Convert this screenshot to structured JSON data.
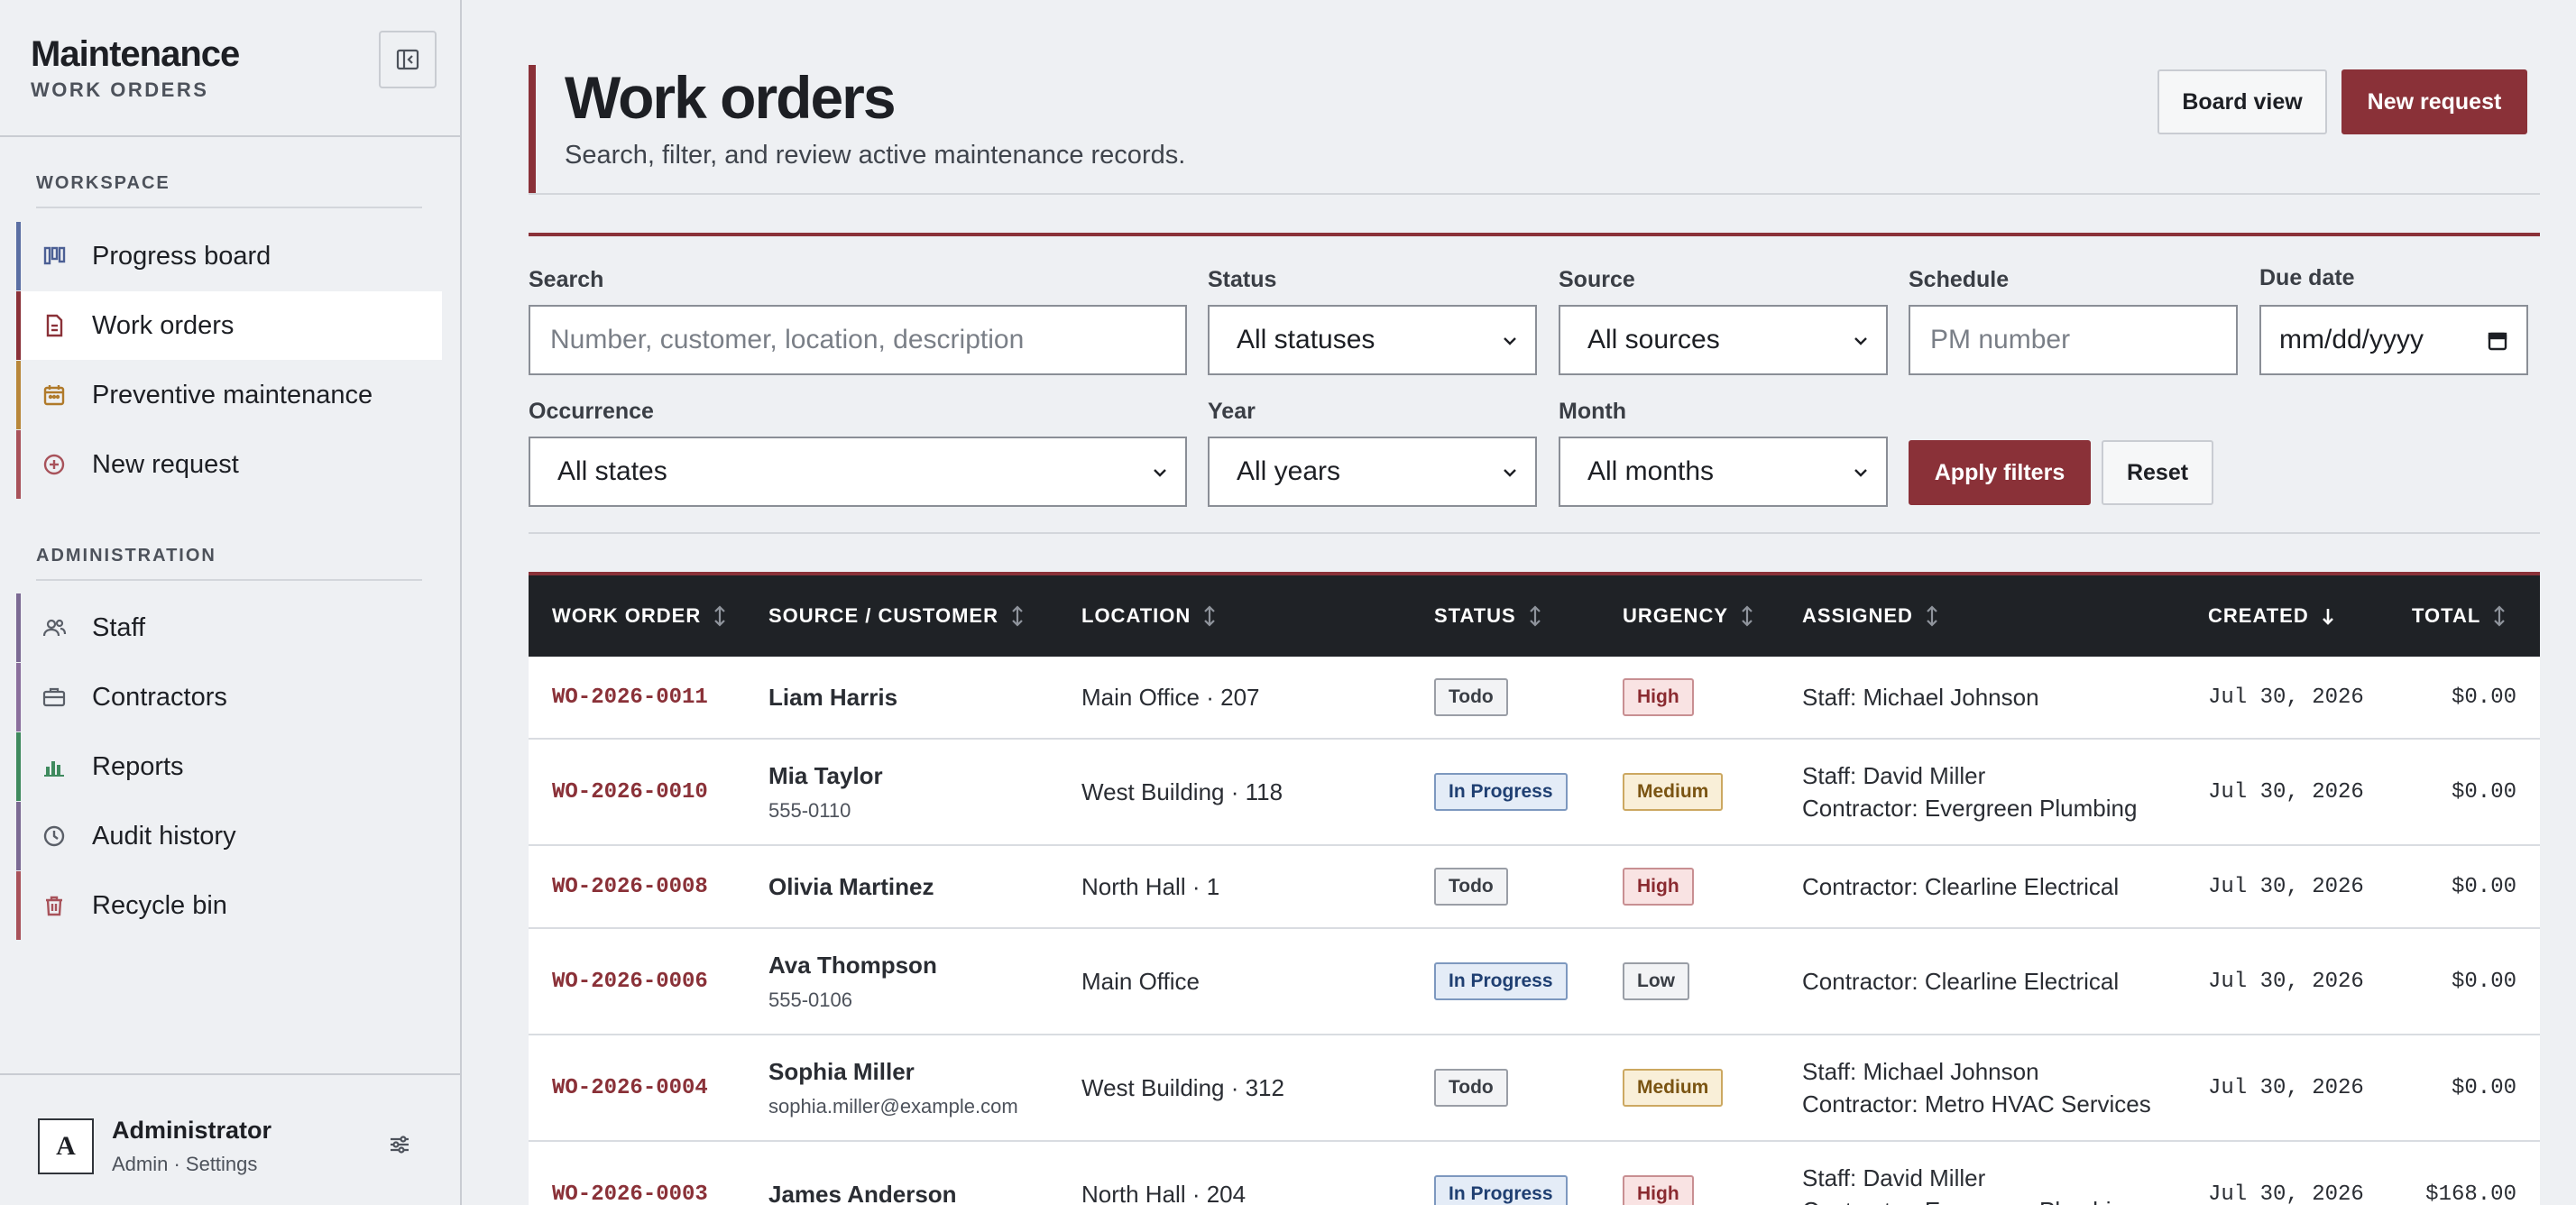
{
  "brand": {
    "title": "Maintenance",
    "subtitle": "WORK ORDERS"
  },
  "sidebar": {
    "workspace_label": "WORKSPACE",
    "admin_label": "ADMINISTRATION",
    "workspace_items": [
      {
        "label": "Progress board",
        "icon": "kanban-icon",
        "color": "#5b6fa3"
      },
      {
        "label": "Work orders",
        "icon": "document-icon",
        "color": "#8a3138",
        "active": true
      },
      {
        "label": "Preventive maintenance",
        "icon": "calendar-icon",
        "color": "#b8873a"
      },
      {
        "label": "New request",
        "icon": "plus-circle-icon",
        "color": "#a8525a"
      }
    ],
    "admin_items": [
      {
        "label": "Staff",
        "icon": "users-icon",
        "color": "#7b6a93"
      },
      {
        "label": "Contractors",
        "icon": "briefcase-icon",
        "color": "#8a6f9c"
      },
      {
        "label": "Reports",
        "icon": "bar-chart-icon",
        "color": "#3f8a5e"
      },
      {
        "label": "Audit history",
        "icon": "clock-icon",
        "color": "#7b6a93"
      },
      {
        "label": "Recycle bin",
        "icon": "trash-icon",
        "color": "#a8525a"
      }
    ]
  },
  "user": {
    "initial": "A",
    "name": "Administrator",
    "role": "Admin · Settings"
  },
  "header": {
    "title": "Work orders",
    "subtitle": "Search, filter, and review active maintenance records.",
    "board_view_label": "Board view",
    "new_request_label": "New request"
  },
  "filters": {
    "search_label": "Search",
    "search_placeholder": "Number, customer, location, description",
    "status_label": "Status",
    "status_value": "All statuses",
    "source_label": "Source",
    "source_value": "All sources",
    "schedule_label": "Schedule",
    "schedule_placeholder": "PM number",
    "due_label": "Due date",
    "due_placeholder": "mm/dd/yyyy",
    "occurrence_label": "Occurrence",
    "occurrence_value": "All states",
    "year_label": "Year",
    "year_value": "All years",
    "month_label": "Month",
    "month_value": "All months",
    "apply_label": "Apply filters",
    "reset_label": "Reset"
  },
  "table": {
    "columns": [
      "WORK ORDER",
      "SOURCE / CUSTOMER",
      "LOCATION",
      "STATUS",
      "URGENCY",
      "ASSIGNED",
      "CREATED",
      "TOTAL"
    ],
    "rows": [
      {
        "id": "WO-2026-0011",
        "customer": "Liam Harris",
        "contact": "",
        "location": "Main Office · 207",
        "status": "Todo",
        "urgency": "High",
        "assigned": [
          "Staff: Michael Johnson"
        ],
        "created": "Jul 30, 2026",
        "total": "$0.00"
      },
      {
        "id": "WO-2026-0010",
        "customer": "Mia Taylor",
        "contact": "555-0110",
        "location": "West Building · 118",
        "status": "In Progress",
        "urgency": "Medium",
        "assigned": [
          "Staff: David Miller",
          "Contractor: Evergreen Plumbing"
        ],
        "created": "Jul 30, 2026",
        "total": "$0.00"
      },
      {
        "id": "WO-2026-0008",
        "customer": "Olivia Martinez",
        "contact": "",
        "location": "North Hall · 1",
        "status": "Todo",
        "urgency": "High",
        "assigned": [
          "Contractor: Clearline Electrical"
        ],
        "created": "Jul 30, 2026",
        "total": "$0.00"
      },
      {
        "id": "WO-2026-0006",
        "customer": "Ava Thompson",
        "contact": "555-0106",
        "location": "Main Office",
        "status": "In Progress",
        "urgency": "Low",
        "assigned": [
          "Contractor: Clearline Electrical"
        ],
        "created": "Jul 30, 2026",
        "total": "$0.00"
      },
      {
        "id": "WO-2026-0004",
        "customer": "Sophia Miller",
        "contact": "sophia.miller@example.com",
        "location": "West Building · 312",
        "status": "Todo",
        "urgency": "Medium",
        "assigned": [
          "Staff: Michael Johnson",
          "Contractor: Metro HVAC Services"
        ],
        "created": "Jul 30, 2026",
        "total": "$0.00"
      },
      {
        "id": "WO-2026-0003",
        "customer": "James Anderson",
        "contact": "",
        "location": "North Hall · 204",
        "status": "In Progress",
        "urgency": "High",
        "assigned": [
          "Staff: David Miller",
          "Contractor: Evergreen Plumbing"
        ],
        "created": "Jul 30, 2026",
        "total": "$168.00"
      }
    ]
  },
  "colors": {
    "accent": "#8a3138",
    "header_dark": "#1f2226"
  }
}
